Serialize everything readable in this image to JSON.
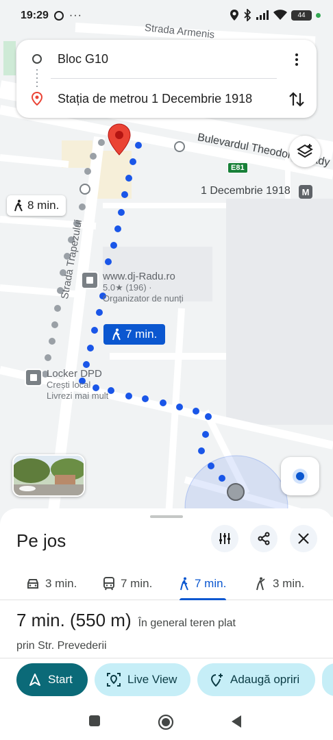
{
  "status_bar": {
    "time": "19:29",
    "battery": "44"
  },
  "directions_card": {
    "origin": "Bloc G10",
    "destination": "Stația de metrou 1 Decembrie 1918"
  },
  "map": {
    "streets": {
      "armeni": "Strada Armenis",
      "boulevard": "Bulevardul Theodor Pallady",
      "trapezului": "Strada Trapezului"
    },
    "route_shield": "E81",
    "metro_label": "1 Decembrie 1918",
    "metro_badge": "M",
    "alt_duration": "8 min.",
    "route_duration": "7 min.",
    "pois": [
      {
        "name": "www.dj-Radu.ro",
        "line2": "5.0★ (196) ·",
        "line3": "Organizator de nunți"
      },
      {
        "name": "Locker DPD",
        "line2": "Crești local",
        "line3": "Livrezi mai mult"
      }
    ]
  },
  "sheet": {
    "title": "Pe jos",
    "modes": [
      {
        "icon": "car-icon",
        "label": "3 min."
      },
      {
        "icon": "transit-icon",
        "label": "7 min."
      },
      {
        "icon": "walk-icon",
        "label": "7 min.",
        "active": true
      },
      {
        "icon": "ride-hail-icon",
        "label": "3 min."
      }
    ],
    "summary_time": "7 min. (550 m)",
    "summary_terrain": "În general teren plat",
    "via": "prin Str. Prevederii",
    "actions": {
      "start": "Start",
      "live_view": "Live View",
      "add_stops": "Adaugă opriri"
    }
  },
  "colors": {
    "route_blue": "#1a56e8",
    "accent_teal": "#0b6a78",
    "pin_red": "#ea4335"
  }
}
